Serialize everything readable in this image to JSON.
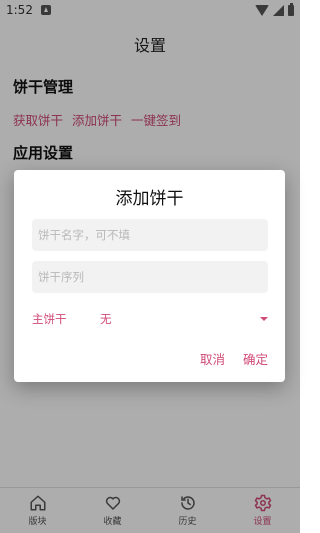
{
  "status_bar": {
    "time": "1:52"
  },
  "app_bar": {
    "title": "设置"
  },
  "cookie_management": {
    "title": "饼干管理",
    "actions": [
      "获取饼干",
      "添加饼干",
      "一键签到"
    ]
  },
  "app_settings": {
    "title": "应用设置"
  },
  "bottom_nav": {
    "items": [
      {
        "label": "版块",
        "icon": "home-icon"
      },
      {
        "label": "收藏",
        "icon": "heart-icon"
      },
      {
        "label": "历史",
        "icon": "history-icon"
      },
      {
        "label": "设置",
        "icon": "gear-icon",
        "active": true
      }
    ]
  },
  "dialog": {
    "title": "添加饼干",
    "name_field": {
      "value": "",
      "placeholder": "饼干名字，可不填"
    },
    "sequence_field": {
      "value": "",
      "placeholder": "饼干序列"
    },
    "primary": {
      "label": "主饼干",
      "value": "无"
    },
    "cancel_label": "取消",
    "confirm_label": "确定"
  },
  "colors": {
    "accent": "#d04b76"
  }
}
